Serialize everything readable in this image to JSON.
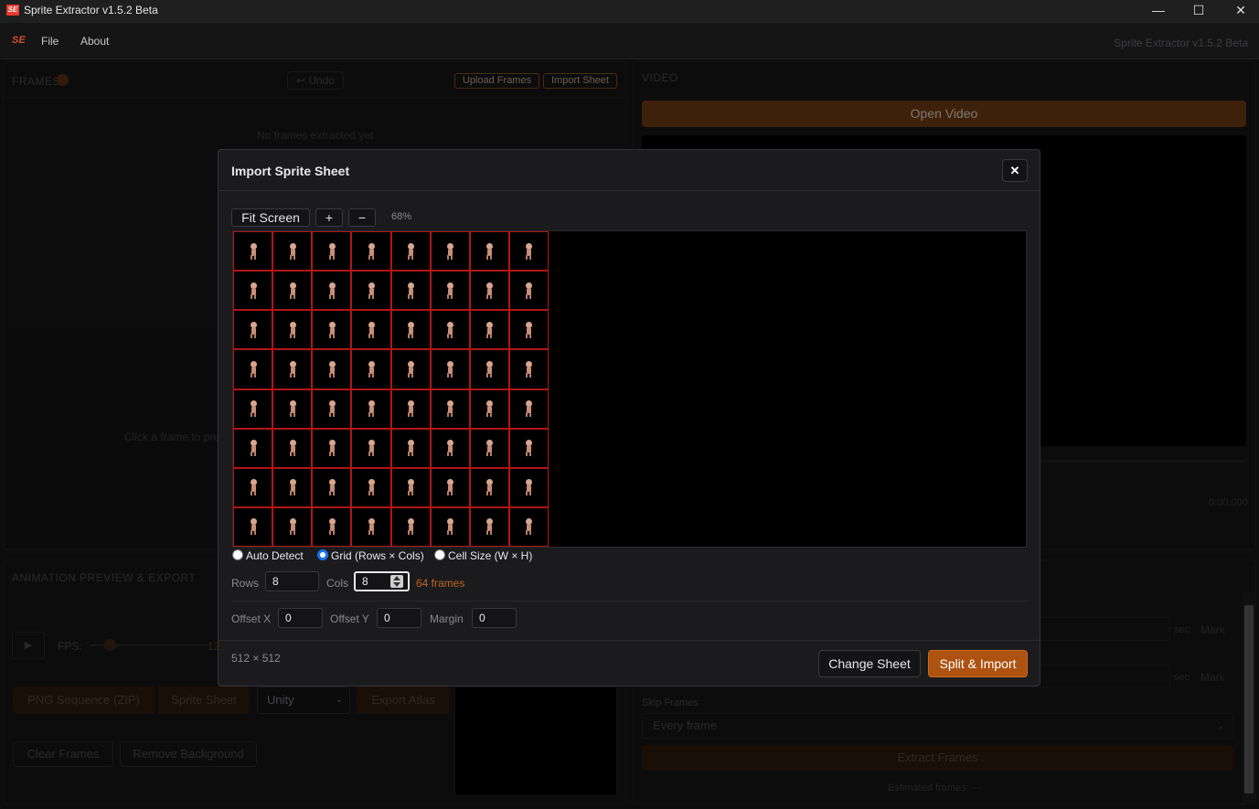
{
  "window": {
    "logo": "SE",
    "title": "Sprite Extractor v1.5.2 Beta",
    "minimize_icon": "—",
    "maximize_icon": "☐",
    "close_icon": "✕"
  },
  "menu": {
    "logo": "SE",
    "file": "File",
    "about": "About",
    "version": "Sprite Extractor v1.5.2 Beta"
  },
  "frames_panel": {
    "header": "FRAMES",
    "undo": "↩ Undo",
    "upload": "Upload Frames",
    "import": "Import Sheet",
    "empty": "No frames extracted yet",
    "preview_hint": "Click a frame to pre"
  },
  "video_panel": {
    "header": "VIDEO",
    "open_video": "Open Video",
    "time": "0:00.000",
    "sec1": "sec",
    "mark1": "Mark",
    "sec2": "sec",
    "mark2": "Mark",
    "skip_label": "Skip Frames",
    "skip_value": "Every frame",
    "extract": "Extract Frames",
    "estimated": "Estimated frames: —"
  },
  "anim_panel": {
    "header": "ANIMATION PREVIEW & EXPORT",
    "fps_label": "FPS:",
    "fps_value": "12",
    "png_seq": "PNG Sequence (ZIP)",
    "sprite_sheet": "Sprite Sheet",
    "engine": "Unity",
    "export_atlas": "Export Atlas",
    "clear": "Clear Frames",
    "remove_bg": "Remove Background"
  },
  "modal": {
    "title": "Import Sprite Sheet",
    "close": "✕",
    "fit_screen": "Fit Screen",
    "zoom_in": "+",
    "zoom_out": "−",
    "zoom": "68%",
    "mode_auto": "Auto Detect",
    "mode_grid": "Grid (Rows × Cols)",
    "mode_cell": "Cell Size (W × H)",
    "selected_mode": "grid",
    "rows_label": "Rows",
    "rows": "8",
    "cols_label": "Cols",
    "cols": "8",
    "frames_count": "64 frames",
    "offset_x_label": "Offset X",
    "offset_x": "0",
    "offset_y_label": "Offset Y",
    "offset_y": "0",
    "margin_label": "Margin",
    "margin": "0",
    "dimensions": "512 × 512",
    "change_sheet": "Change Sheet",
    "split_import": "Split & Import"
  },
  "colors": {
    "accent": "#ae5211",
    "grid_line": "#b31616",
    "frames_count": "#c0651f"
  }
}
